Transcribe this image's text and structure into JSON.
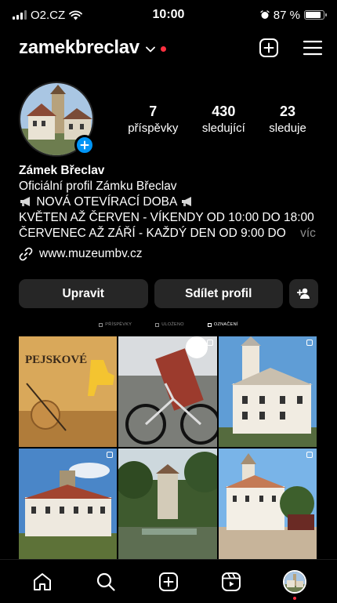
{
  "status_bar": {
    "carrier": "O2.CZ",
    "time": "10:00",
    "battery_label": "87 %",
    "battery_level": 0.87
  },
  "header": {
    "username": "zamekbreclav"
  },
  "profile": {
    "stats": [
      {
        "value": "7",
        "label": "příspěvky"
      },
      {
        "value": "430",
        "label": "sledující"
      },
      {
        "value": "23",
        "label": "sleduje"
      }
    ]
  },
  "bio": {
    "name": "Zámek Břeclav",
    "line1": "Oficiální profil Zámku Břeclav",
    "line2": "NOVÁ OTEVÍRACÍ DOBA",
    "line3": "KVĚTEN AŽ ČERVEN - VÍKENDY OD 10:00 DO 18:00",
    "line4": "ČERVENEC AŽ ZÁŘÍ - KAŽDÝ DEN OD 9:00 DO",
    "more": "víc",
    "website": "www.muzeumbv.cz"
  },
  "buttons": {
    "edit": "Upravit",
    "share": "Sdílet profil"
  },
  "tabs": {
    "posts": "PŘÍSPĚVKY",
    "saved": "ULOŽENO",
    "tagged": "OZNAČENÍ"
  },
  "grid": {
    "cell1_text": "PEJSKOVÉ"
  },
  "colors": {
    "accent_blue": "#0095f6",
    "notification_red": "#ff3040",
    "button_bg": "#262626"
  }
}
